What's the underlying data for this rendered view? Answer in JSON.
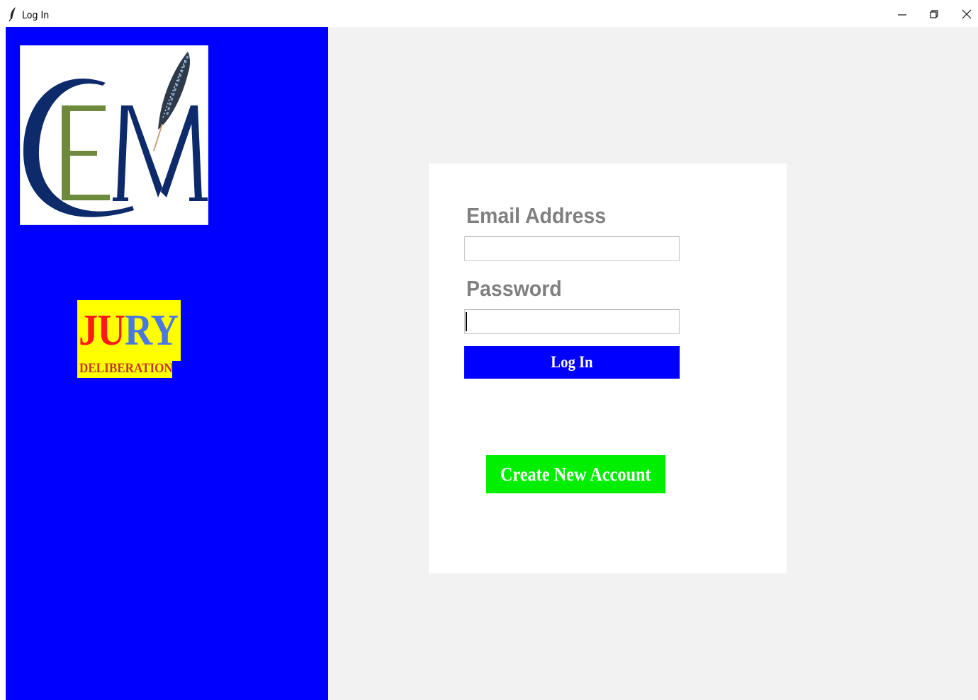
{
  "window": {
    "title": "Log In",
    "icon": "feather-icon",
    "controls": [
      "minimize-icon",
      "restore-icon",
      "close-icon"
    ]
  },
  "sidebar": {
    "background": "#0000ff",
    "logo": {
      "letters": "CEM",
      "icon": "feather-icon",
      "colors": {
        "c": "#0d2a6b",
        "e": "#6e8b3d",
        "m": "#0d2a6b"
      }
    },
    "badge": {
      "word_red": "JU",
      "word_blue": "RY",
      "subtitle": "DELIBERATION",
      "background": "#ffff00",
      "red": "#ff1a1a",
      "blue": "#4a78e0",
      "subtitle_color": "#c0392b"
    }
  },
  "form": {
    "email_label": "Email Address",
    "email_value": "",
    "password_label": "Password",
    "password_value": "",
    "login_label": "Log In",
    "login_color": "#0000ff",
    "create_label": "Create New Account",
    "create_color": "#00ee00"
  }
}
